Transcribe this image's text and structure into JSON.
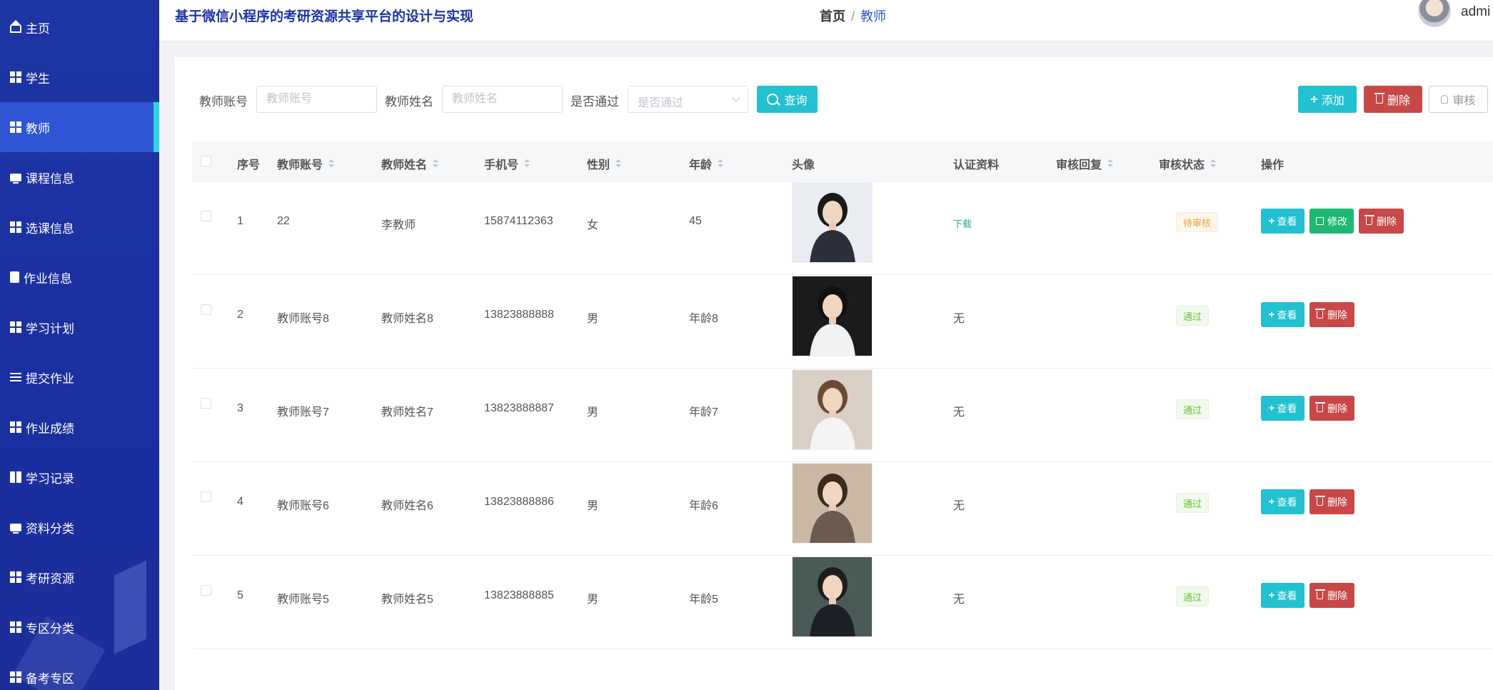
{
  "app": {
    "title": "基于微信小程序的考研资源共享平台的设计与实现"
  },
  "breadcrumb": {
    "home": "首页",
    "sep": "/",
    "current": "教师"
  },
  "user": {
    "name": "admi"
  },
  "sidebar": {
    "items": [
      {
        "label": "主页",
        "icon": "home-icon"
      },
      {
        "label": "学生",
        "icon": "grid-icon"
      },
      {
        "label": "教师",
        "icon": "grid-icon",
        "active": true
      },
      {
        "label": "课程信息",
        "icon": "monitor-icon"
      },
      {
        "label": "选课信息",
        "icon": "grid-icon"
      },
      {
        "label": "作业信息",
        "icon": "clipboard-icon"
      },
      {
        "label": "学习计划",
        "icon": "grid-icon"
      },
      {
        "label": "提交作业",
        "icon": "sliders-icon"
      },
      {
        "label": "作业成绩",
        "icon": "grid-icon"
      },
      {
        "label": "学习记录",
        "icon": "book-icon"
      },
      {
        "label": "资料分类",
        "icon": "monitor-icon"
      },
      {
        "label": "考研资源",
        "icon": "grid-icon"
      },
      {
        "label": "专区分类",
        "icon": "grid-icon"
      },
      {
        "label": "备考专区",
        "icon": "grid-icon"
      }
    ]
  },
  "search": {
    "account_label": "教师账号",
    "account_placeholder": "教师账号",
    "name_label": "教师姓名",
    "name_placeholder": "教师姓名",
    "pass_label": "是否通过",
    "pass_placeholder": "是否通过",
    "query_label": "查询"
  },
  "actions": {
    "add": "添加",
    "delete": "删除",
    "review": "审核"
  },
  "table": {
    "headers": {
      "index": "序号",
      "account": "教师账号",
      "name": "教师姓名",
      "phone": "手机号",
      "gender": "性别",
      "age": "年龄",
      "avatar": "头像",
      "cert": "认证资料",
      "reply": "审核回复",
      "status": "审核状态",
      "ops": "操作"
    },
    "row_buttons": {
      "view": "查看",
      "edit": "修改",
      "delete": "删除"
    },
    "rows": [
      {
        "index": "1",
        "account": "22",
        "name": "李教师",
        "phone": "15874112363",
        "gender": "女",
        "age": "45",
        "cert": "下载",
        "status": "待审核",
        "status_type": "pending",
        "can_edit": true
      },
      {
        "index": "2",
        "account": "教师账号8",
        "name": "教师姓名8",
        "phone": "13823888888",
        "gender": "男",
        "age": "年龄8",
        "cert": "无",
        "status": "通过",
        "status_type": "pass",
        "can_edit": false
      },
      {
        "index": "3",
        "account": "教师账号7",
        "name": "教师姓名7",
        "phone": "13823888887",
        "gender": "男",
        "age": "年龄7",
        "cert": "无",
        "status": "通过",
        "status_type": "pass",
        "can_edit": false
      },
      {
        "index": "4",
        "account": "教师账号6",
        "name": "教师姓名6",
        "phone": "13823888886",
        "gender": "男",
        "age": "年龄6",
        "cert": "无",
        "status": "通过",
        "status_type": "pass",
        "can_edit": false
      },
      {
        "index": "5",
        "account": "教师账号5",
        "name": "教师姓名5",
        "phone": "13823888885",
        "gender": "男",
        "age": "年龄5",
        "cert": "无",
        "status": "通过",
        "status_type": "pass",
        "can_edit": false
      }
    ]
  },
  "colors": {
    "sidebar": "#1d35a3",
    "accent": "#22c0d1",
    "danger": "#c84848",
    "success": "#1fb872"
  }
}
